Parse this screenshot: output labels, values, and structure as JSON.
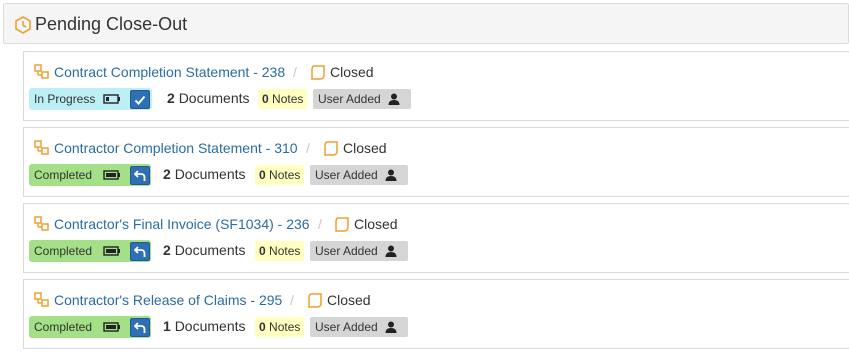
{
  "panel": {
    "title": "Pending Close-Out"
  },
  "colors": {
    "accent_orange": "#f0a030",
    "link_blue": "#2b6ca3",
    "in_progress_bg": "#bdf0f5",
    "completed_bg": "#a3e087",
    "notes_bg": "#ffffc2",
    "user_added_bg": "#d5d5d5",
    "action_button": "#2f6fb3"
  },
  "items": [
    {
      "title": "Contract Completion Statement - 238",
      "closed_label": "Closed",
      "status": "In Progress",
      "status_type": "inprogress",
      "action_icon": "checkmark-icon",
      "doc_count": "2",
      "doc_label": "Documents",
      "notes_count": "0",
      "notes_label": "Notes",
      "user_added": "User Added"
    },
    {
      "title": "Contractor Completion Statement - 310",
      "closed_label": "Closed",
      "status": "Completed",
      "status_type": "completed",
      "action_icon": "undo-icon",
      "doc_count": "2",
      "doc_label": "Documents",
      "notes_count": "0",
      "notes_label": "Notes",
      "user_added": "User Added"
    },
    {
      "title": "Contractor's Final Invoice (SF1034) - 236",
      "closed_label": "Closed",
      "status": "Completed",
      "status_type": "completed",
      "action_icon": "undo-icon",
      "doc_count": "2",
      "doc_label": "Documents",
      "notes_count": "0",
      "notes_label": "Notes",
      "user_added": "User Added"
    },
    {
      "title": "Contractor's Release of Claims - 295",
      "closed_label": "Closed",
      "status": "Completed",
      "status_type": "completed",
      "action_icon": "undo-icon",
      "doc_count": "1",
      "doc_label": "Documents",
      "notes_count": "0",
      "notes_label": "Notes",
      "user_added": "User Added"
    }
  ]
}
